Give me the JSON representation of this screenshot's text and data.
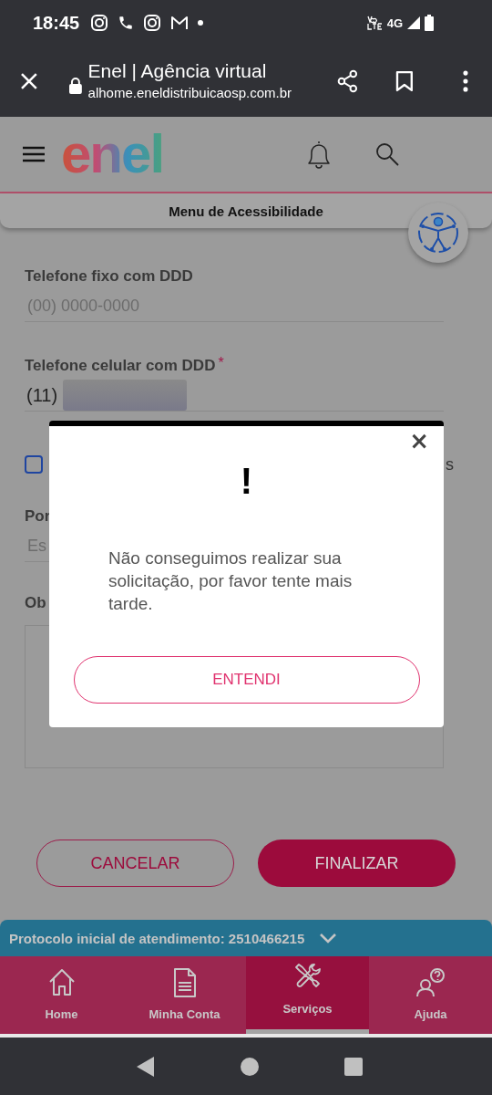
{
  "status_bar": {
    "time": "18:45",
    "network": "4G"
  },
  "browser": {
    "title": "Enel | Agência virtual",
    "url": "alhome.eneldistribuicaosp.com.br"
  },
  "header": {
    "logo": "enel"
  },
  "accessibility_menu": {
    "label": "Menu de Acessibilidade"
  },
  "form": {
    "fields": [
      {
        "kind": "input",
        "label": "Telefone fixo com DDD",
        "placeholder": "(00) 0000-0000"
      },
      {
        "kind": "input",
        "label": "Telefone celular com DDD",
        "required_mark": "*",
        "value": "(11)",
        "redacted": true
      },
      {
        "kind": "checkbox",
        "checked": false,
        "label": "s"
      },
      {
        "kind": "select",
        "label": "Por",
        "placeholder": "Es"
      },
      {
        "kind": "textarea",
        "label": "Ob"
      }
    ]
  },
  "buttons": [
    {
      "label": "CANCELAR",
      "kind": "secondary"
    },
    {
      "label": "FINALIZAR",
      "kind": "primary"
    }
  ],
  "protocol_bar": {
    "text": "Protocolo inicial de atendimento: 2510466215",
    "expanded": false
  },
  "bottom_nav": [
    {
      "label": "Home",
      "kind": "home",
      "selected": false
    },
    {
      "label": "Minha Conta",
      "kind": "document",
      "selected": false
    },
    {
      "label": "Serviços",
      "kind": "tools",
      "selected": true
    },
    {
      "label": "Ajuda",
      "kind": "help",
      "selected": false
    }
  ],
  "dialog": {
    "close": "×",
    "icon": "!",
    "message": "Não conseguimos realizar sua solicitação, por favor tente mais tarde.",
    "button": "ENTENDI"
  }
}
